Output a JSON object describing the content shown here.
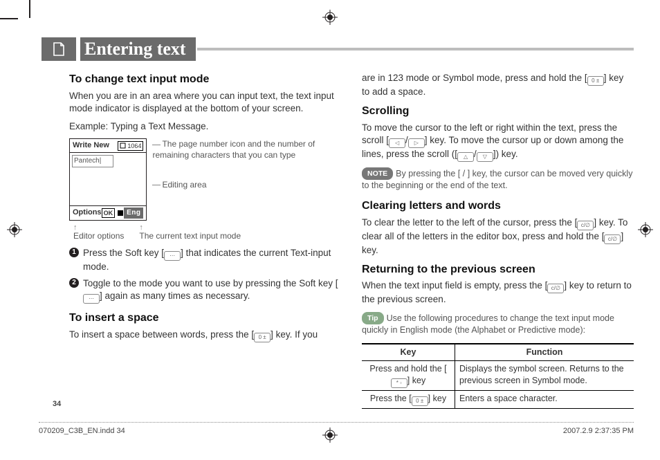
{
  "header": {
    "title": "Entering text"
  },
  "page_number": "34",
  "footer": {
    "file": "070209_C3B_EN.indd   34",
    "timestamp": "2007.2.9   2:37:35 PM"
  },
  "left": {
    "h1": "To change text input mode",
    "p1": "When you are in an area where you can input text, the text input mode indicator is displayed at the bottom of your screen.",
    "p2": "Example: Typing a Text Message.",
    "shot": {
      "title": "Write New",
      "counter": "1064",
      "sample": "Pantech|",
      "options": "Options",
      "ok": "OK",
      "eng": "Eng"
    },
    "co1": "The page number icon and the number of remaining characters that you can type",
    "co2": "Editing area",
    "co3": "Editor options",
    "co4": "The current text input mode",
    "li1": "Press the Soft key [",
    "li1b": "] that indicates the current Text-input mode.",
    "li2": "Toggle to the mode you want to use by pressing the Soft key [",
    "li2b": "] again as many times as necessary.",
    "h2": "To insert a space",
    "p3a": "To insert a space between words, press the [",
    "p3b": "] key. If you"
  },
  "right": {
    "p0a": "are in 123 mode or Symbol mode, press and hold the [",
    "p0b": "] key to add a space.",
    "h1": "Scrolling",
    "p1a": "To move the cursor to the left or right within the text, press the scroll [",
    "p1b": "] key. To move the cursor up or down among the lines, press the scroll ([",
    "p1c": "]) key.",
    "note_label": "NOTE",
    "note": "By pressing the [ / ] key, the cursor can be moved very quickly to the beginning or the end of the text.",
    "h2": "Clearing letters and words",
    "p2a": "To clear the letter to the left of the cursor, press the [",
    "p2b": "] key. To clear all of the letters in the editor box, press and hold the [",
    "p2c": "] key.",
    "h3": "Returning to the previous screen",
    "p3a": "When the text input field is empty, press the [",
    "p3b": "] key to return to the previous screen.",
    "tip_label": "Tip",
    "tip": "Use the following procedures to change the text input mode quickly in English mode (the Alphabet or Predictive mode):",
    "table": {
      "h_key": "Key",
      "h_fn": "Function",
      "r1k_a": "Press and hold the [",
      "r1k_b": "] key",
      "r1f": "Displays the symbol screen. Returns to the previous screen in Symbol mode.",
      "r2k_a": "Press the [",
      "r2k_b": "] key",
      "r2f": "Enters a space character."
    }
  }
}
